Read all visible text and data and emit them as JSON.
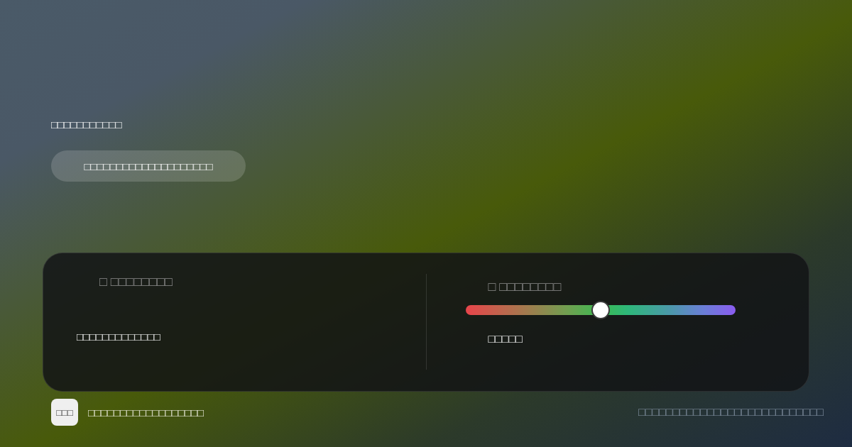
{
  "hero": {
    "heading": "□□□□□□□□□□□",
    "pill": "□□□□□□□□□□□□□□□□□□□□"
  },
  "panel": {
    "fields": [
      {
        "kind": "text",
        "label": "□ □□□□□□□□",
        "value": "□□□□□□□□□□□□□"
      },
      {
        "kind": "slider",
        "label": "□ □□□□□□□□",
        "level": 0.5,
        "value": "□□□□□"
      }
    ]
  },
  "footer": {
    "badge": "□□□",
    "text": "□□□□□□□□□□□□□□□□□□",
    "note": "□□□□□□□□□□□□□□□□□□□□□□□□□□□"
  }
}
